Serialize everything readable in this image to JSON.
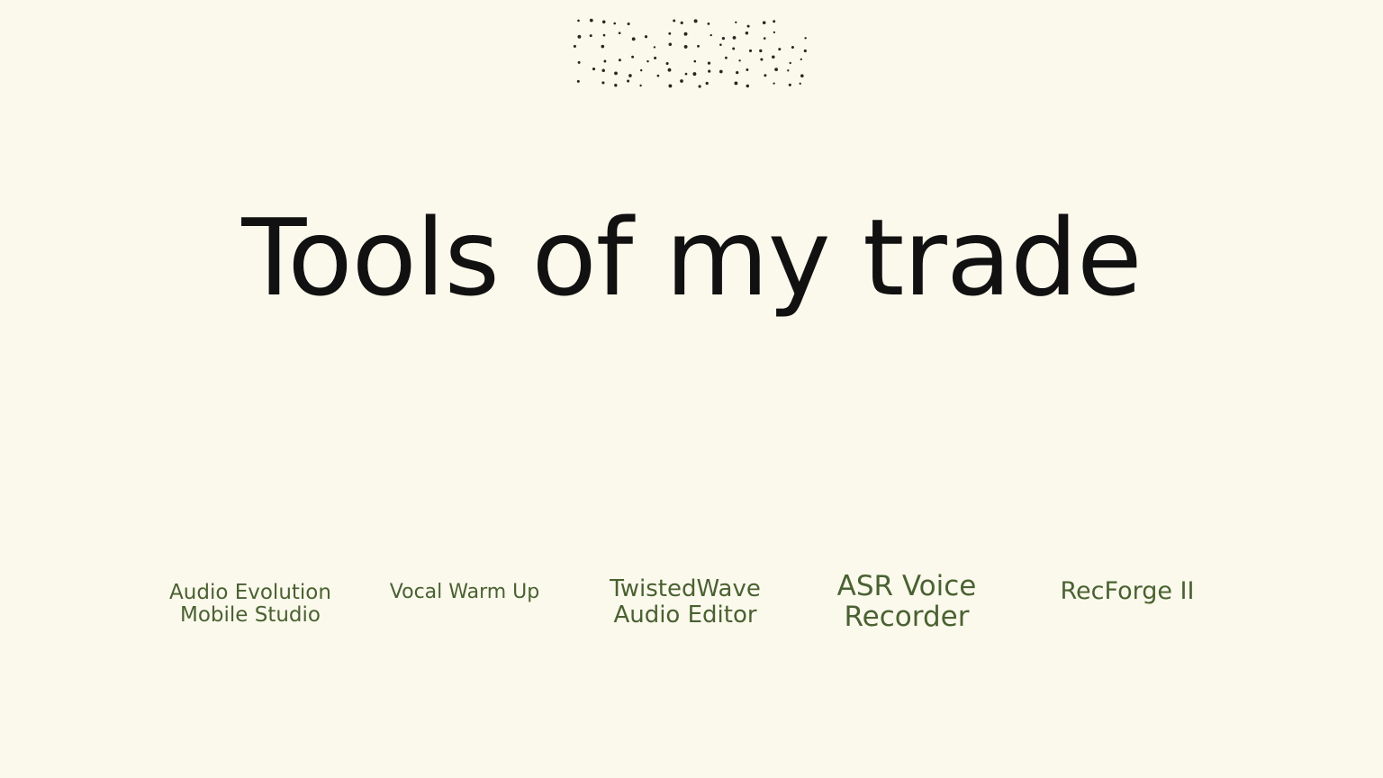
{
  "slide": {
    "title": "Tools of my trade",
    "background_color": "#fbf9ec",
    "title_color": "#111111",
    "tool_color": "#4a6132",
    "decoration": "dot-pattern"
  },
  "tools": [
    {
      "name": "Audio Evolution\nMobile Studio"
    },
    {
      "name": "Vocal Warm Up"
    },
    {
      "name": "TwistedWave\nAudio Editor"
    },
    {
      "name": "ASR Voice\nRecorder"
    },
    {
      "name": "RecForge II"
    }
  ]
}
